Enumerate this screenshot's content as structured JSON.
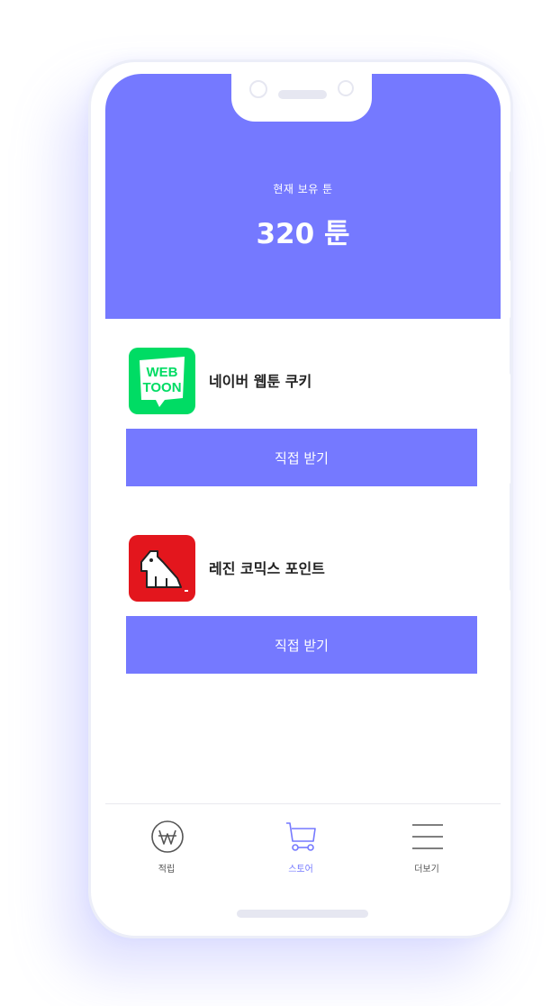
{
  "balance": {
    "label": "현재 보유 툰",
    "value": "320 툰"
  },
  "apps": [
    {
      "name": "네이버 웹툰 쿠키",
      "icon": "webtoon-logo",
      "icon_text_line1": "WEB",
      "icon_text_line2": "TOON",
      "icon_color": "#00dc64",
      "button_label": "직접 받기"
    },
    {
      "name": "레진 코믹스 포인트",
      "icon": "lezhin-dog-logo",
      "icon_color": "#e3161d",
      "button_label": "직접 받기"
    }
  ],
  "nav": [
    {
      "label": "적립",
      "icon": "won-coin-icon",
      "active": false
    },
    {
      "label": "스토어",
      "icon": "cart-icon",
      "active": true
    },
    {
      "label": "더보기",
      "icon": "menu-icon",
      "active": false
    }
  ],
  "colors": {
    "accent": "#7579ff",
    "webtoon_green": "#00dc64",
    "lezhin_red": "#e3161d"
  }
}
